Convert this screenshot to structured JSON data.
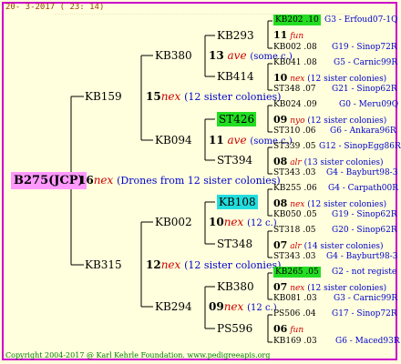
{
  "header": {
    "date": "20- 3-2017 ( 23: 14)"
  },
  "footer": {
    "copyright": "Copyright 2004-2017 @ Karl Kehrle Foundation.   www.pedigreeapis.org"
  },
  "colors": {
    "frame": "#cc00cc",
    "background": "#ffffdd",
    "root_highlight": "#ff99ff",
    "green_highlight": "#22dd22",
    "cyan_highlight": "#22dddd",
    "tag": "#cc0000",
    "note": "#0000cc"
  },
  "tree": {
    "root": {
      "name": "B275(JCP)",
      "num": "16",
      "tag": "nex",
      "note": "(Drones from 12 sister colonies)"
    },
    "kb159": {
      "name": "KB159",
      "num": "15",
      "tag": "nex",
      "note": "(12 sister colonies)"
    },
    "kb315": {
      "name": "KB315",
      "num": "12",
      "tag": "nex",
      "note": "(12 sister colonies)"
    },
    "kb380a": {
      "name": "KB380",
      "num": "13",
      "tag": "ave",
      "note": "(some c.)"
    },
    "kb094": {
      "name": "KB094",
      "num": "11",
      "tag": "ave",
      "note": "(some c.)"
    },
    "kb002": {
      "name": "KB002",
      "num": "10",
      "tag": "nex",
      "note": "(12 c.)"
    },
    "kb294": {
      "name": "KB294",
      "num": "09",
      "tag": "nex",
      "note": "(12 c.)"
    },
    "kb293": {
      "name": "KB293",
      "num": "11",
      "tag": "fun"
    },
    "kb414": {
      "name": "KB414",
      "num": "10",
      "tag": "nex",
      "note": "(12 sister colonies)"
    },
    "st426": {
      "name": "ST426",
      "num": "09",
      "tag": "nyo",
      "note": "(12 sister colonies)"
    },
    "st394": {
      "name": "ST394",
      "num": "08",
      "tag": "alr",
      "note": "(13 sister colonies)"
    },
    "kb108": {
      "name": "KB108",
      "num": "08",
      "tag": "nex",
      "note": "(12 sister colonies)"
    },
    "st348": {
      "name": "ST348",
      "num": "07",
      "tag": "alr",
      "note": "(14 sister colonies)"
    },
    "kb380b": {
      "name": "KB380",
      "num": "07",
      "tag": "nex",
      "note": "(12 sister colonies)"
    },
    "ps596": {
      "name": "PS596",
      "num": "06",
      "tag": "fun"
    }
  },
  "gen5": [
    {
      "code": "KB202 .10",
      "group": "G3 - Erfoud07-1Q"
    },
    {
      "code": "KB002 .08",
      "group": "G19 - Sinop72R"
    },
    {
      "code": "KB041 .08",
      "group": "G5 - Carnic99R"
    },
    {
      "code": "ST348 .07",
      "group": "G21 - Sinop62R"
    },
    {
      "code": "KB024 .09",
      "group": "G0 - Meru09Q"
    },
    {
      "code": "ST310 .06",
      "group": "G6 - Ankara96R"
    },
    {
      "code": "ST339 .05",
      "group": "G12 - SinopEgg86R"
    },
    {
      "code": "ST343 .03",
      "group": "G4 - Bayburt98-3"
    },
    {
      "code": "KB255 .06",
      "group": "G4 - Carpath00R"
    },
    {
      "code": "KB050 .05",
      "group": "G19 - Sinop62R"
    },
    {
      "code": "ST318 .05",
      "group": "G20 - Sinop62R"
    },
    {
      "code": "ST343 .03",
      "group": "G4 - Bayburt98-3"
    },
    {
      "code": "KB265 .05",
      "group": "G2 - not registe"
    },
    {
      "code": "KB081 .03",
      "group": "G3 - Carnic99R"
    },
    {
      "code": "PS506 .04",
      "group": "G17 - Sinop72R"
    },
    {
      "code": "KB169 .03",
      "group": "G6 - Maced93R"
    }
  ]
}
